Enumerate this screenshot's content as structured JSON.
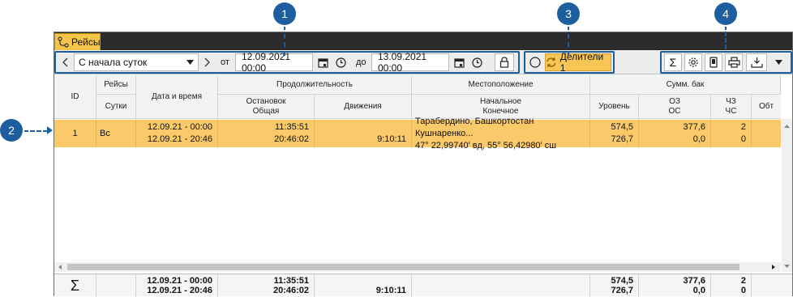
{
  "callouts": [
    "1",
    "2",
    "3",
    "4"
  ],
  "tab": {
    "label": "Рейсы",
    "icon": "route-icon"
  },
  "toolbar": {
    "period_select": "С начала суток",
    "from_label": "от",
    "from_value": "12.09.2021 00:00",
    "to_label": "до",
    "to_value": "13.09.2021 00:00",
    "dividers_label": "Делители 1",
    "sum_label": "Σ"
  },
  "columns": {
    "id": "ID",
    "trips": "Рейсы",
    "day": "Сутки",
    "datetime": "Дата и время",
    "duration": "Продолжительность",
    "stops_total_1": "Остановок",
    "stops_total_2": "Общая",
    "movement": "Движения",
    "location": "Местоположение",
    "location_start": "Начальное",
    "location_end": "Конечное",
    "tank": "Сумм. бак",
    "level": "Уровень",
    "oz_1": "ОЗ",
    "oz_2": "ОС",
    "chz_1": "ЧЗ",
    "chz_2": "ЧС",
    "obt": "Обт"
  },
  "rows": [
    {
      "id": "1",
      "day": "Вс",
      "datetime_1": "12.09.21 - 00:00",
      "datetime_2": "12.09.21 - 20:46",
      "stops": "11:35:51",
      "total": "20:46:02",
      "movement": "9:10:11",
      "location_1": "Тарабердино, Башкортостан Кушнаренко...",
      "location_2": "47° 22,99740' вд, 55° 56,42980' сш",
      "level_1": "574,5",
      "level_2": "726,7",
      "oz_1": "377,6",
      "oz_2": "0,0",
      "chz_1": "2",
      "chz_2": "0"
    }
  ],
  "footer": {
    "sum_symbol": "Σ",
    "datetime_1": "12.09.21 - 00:00",
    "datetime_2": "12.09.21 - 20:46",
    "stops": "11:35:51",
    "total": "20:46:02",
    "movement": "9:10:11",
    "level_1": "574,5",
    "level_2": "726,7",
    "oz_1": "377,6",
    "oz_2": "0,0",
    "chz_1": "2",
    "chz_2": "0"
  }
}
